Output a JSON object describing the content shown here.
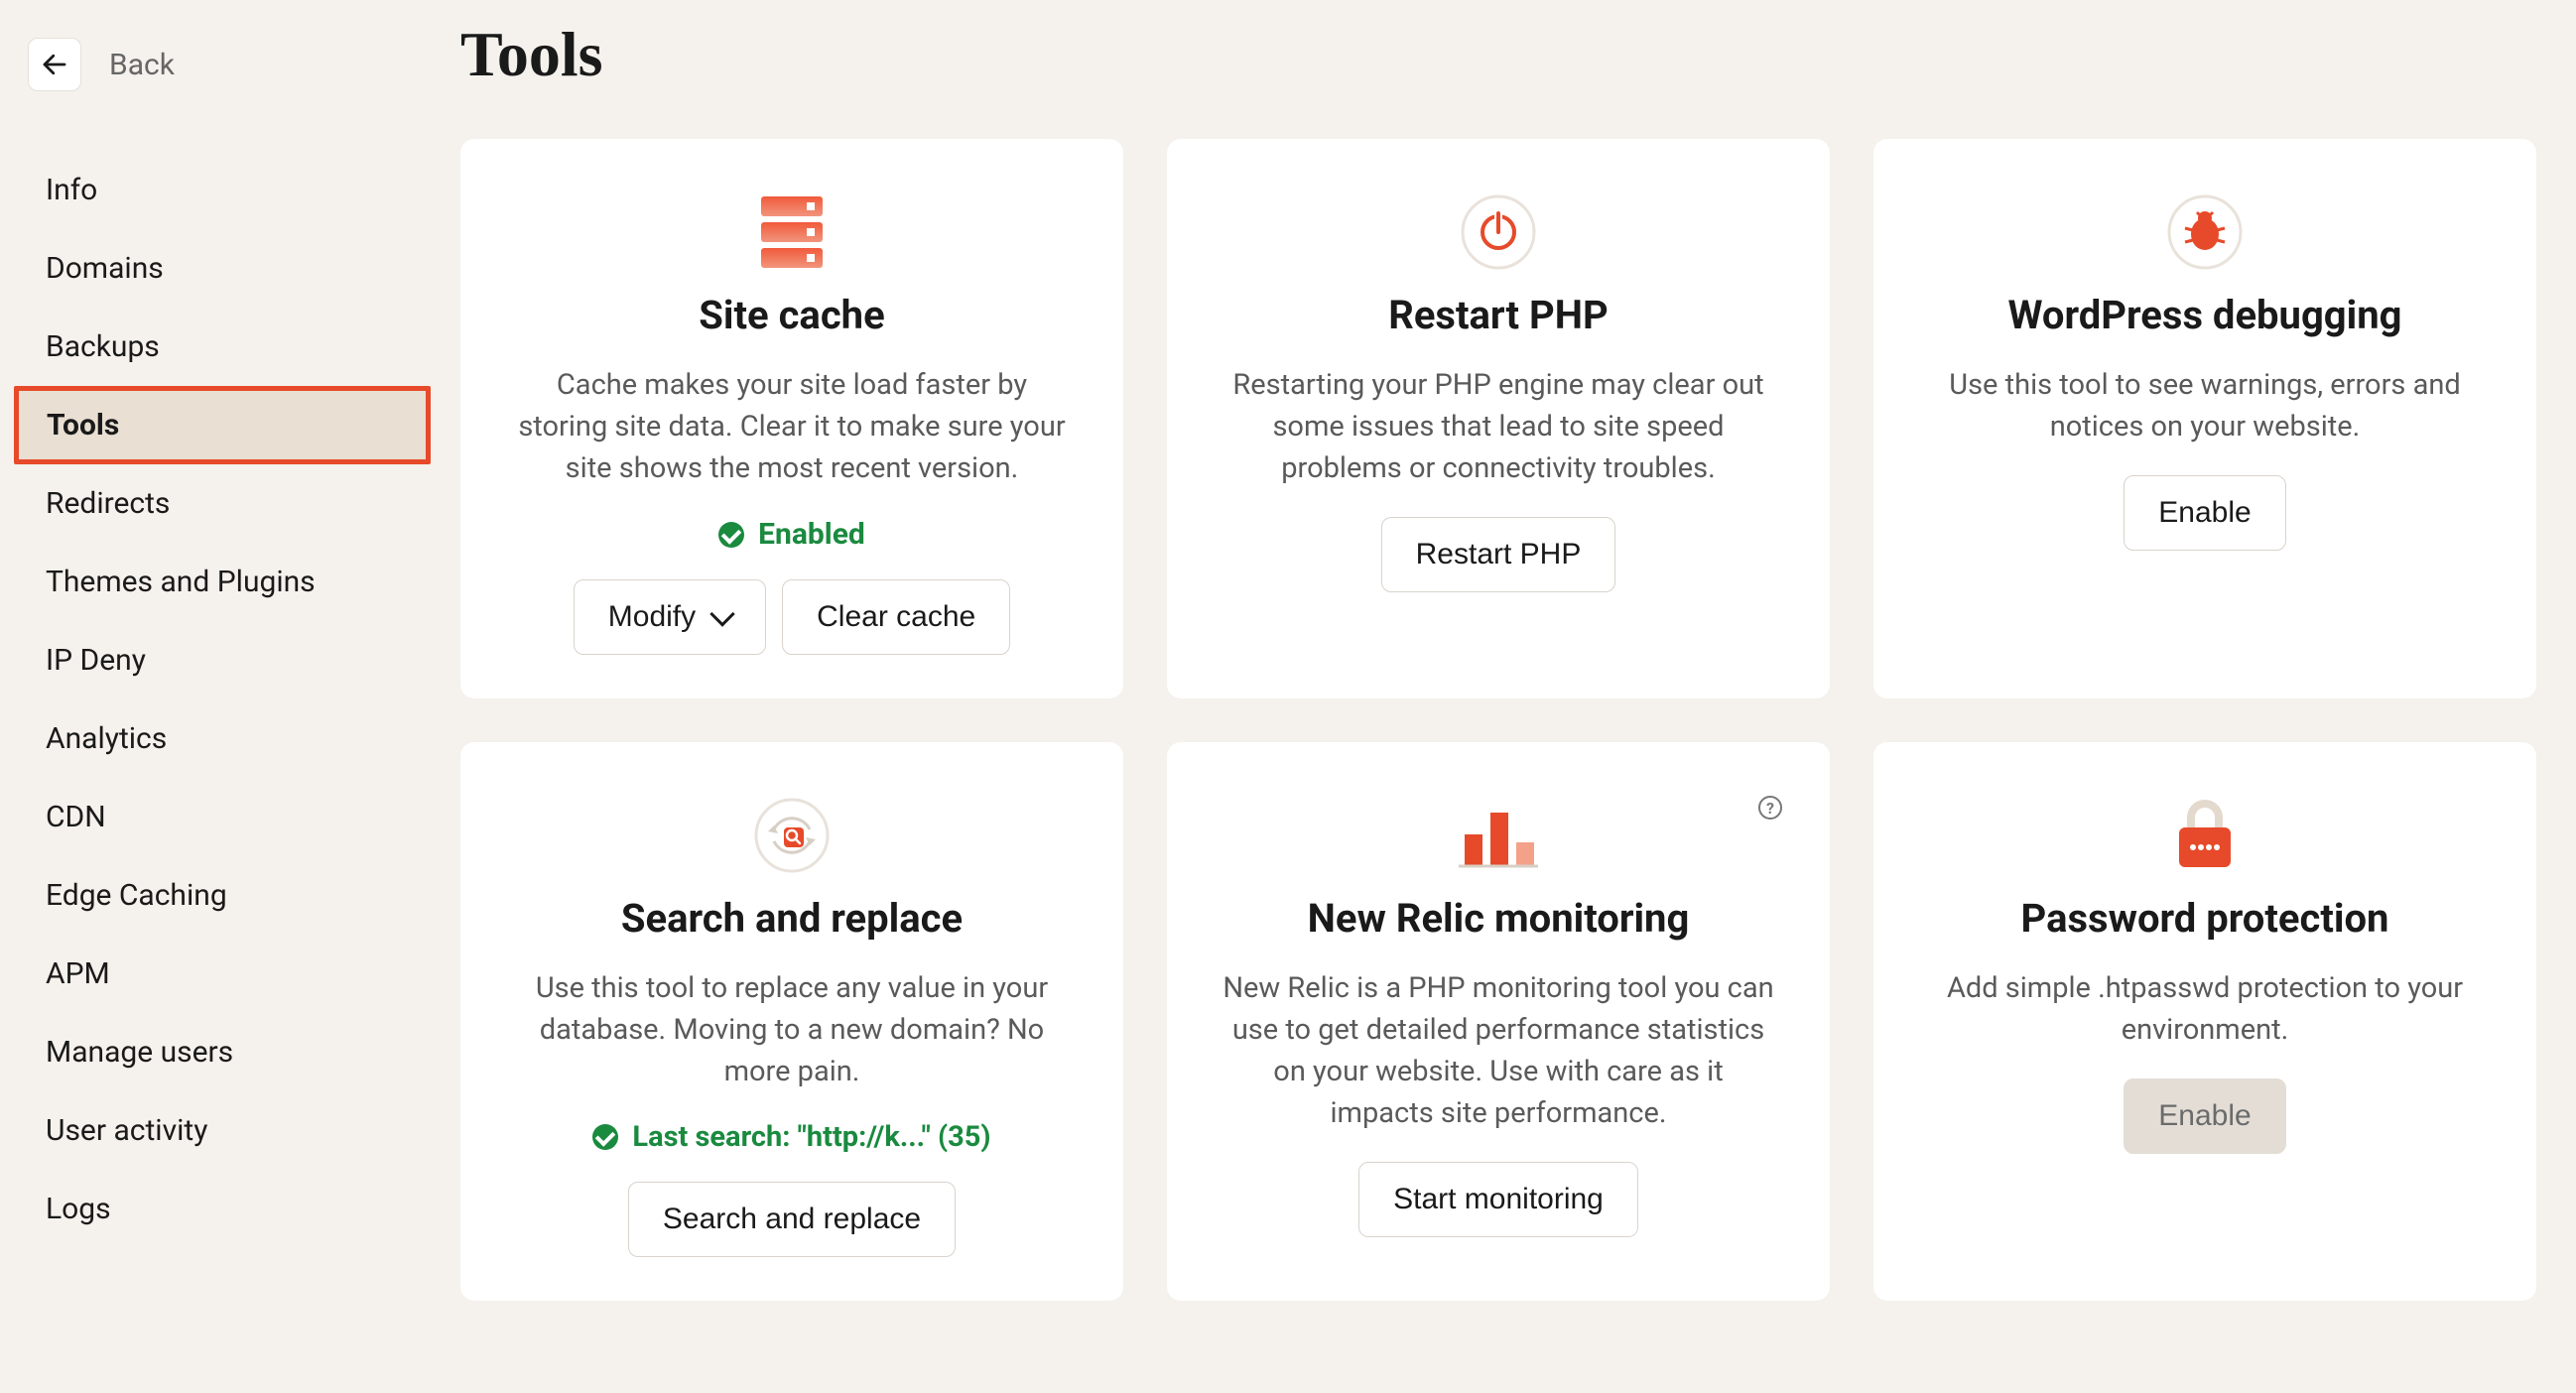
{
  "back_label": "Back",
  "page_title": "Tools",
  "sidebar": {
    "items": [
      {
        "label": "Info",
        "active": false
      },
      {
        "label": "Domains",
        "active": false
      },
      {
        "label": "Backups",
        "active": false
      },
      {
        "label": "Tools",
        "active": true
      },
      {
        "label": "Redirects",
        "active": false
      },
      {
        "label": "Themes and Plugins",
        "active": false
      },
      {
        "label": "IP Deny",
        "active": false
      },
      {
        "label": "Analytics",
        "active": false
      },
      {
        "label": "CDN",
        "active": false
      },
      {
        "label": "Edge Caching",
        "active": false
      },
      {
        "label": "APM",
        "active": false
      },
      {
        "label": "Manage users",
        "active": false
      },
      {
        "label": "User activity",
        "active": false
      },
      {
        "label": "Logs",
        "active": false
      }
    ]
  },
  "cards": {
    "site_cache": {
      "title": "Site cache",
      "desc": "Cache makes your site load faster by storing site data. Clear it to make sure your site shows the most recent version.",
      "status": "Enabled",
      "modify_label": "Modify",
      "clear_label": "Clear cache"
    },
    "restart_php": {
      "title": "Restart PHP",
      "desc": "Restarting your PHP engine may clear out some issues that lead to site speed problems or connectivity troubles.",
      "button": "Restart PHP"
    },
    "wp_debug": {
      "title": "WordPress debugging",
      "desc": "Use this tool to see warnings, errors and notices on your website.",
      "button": "Enable"
    },
    "search_replace": {
      "title": "Search and replace",
      "desc": "Use this tool to replace any value in your database. Moving to a new domain? No more pain.",
      "status": "Last search: \"http://k...\" (35)",
      "button": "Search and replace"
    },
    "new_relic": {
      "title": "New Relic monitoring",
      "desc": "New Relic is a PHP monitoring tool you can use to get detailed performance statistics on your website. Use with care as it impacts site performance.",
      "button": "Start monitoring"
    },
    "password": {
      "title": "Password protection",
      "desc": "Add simple .htpasswd protection to your environment.",
      "button": "Enable"
    }
  }
}
